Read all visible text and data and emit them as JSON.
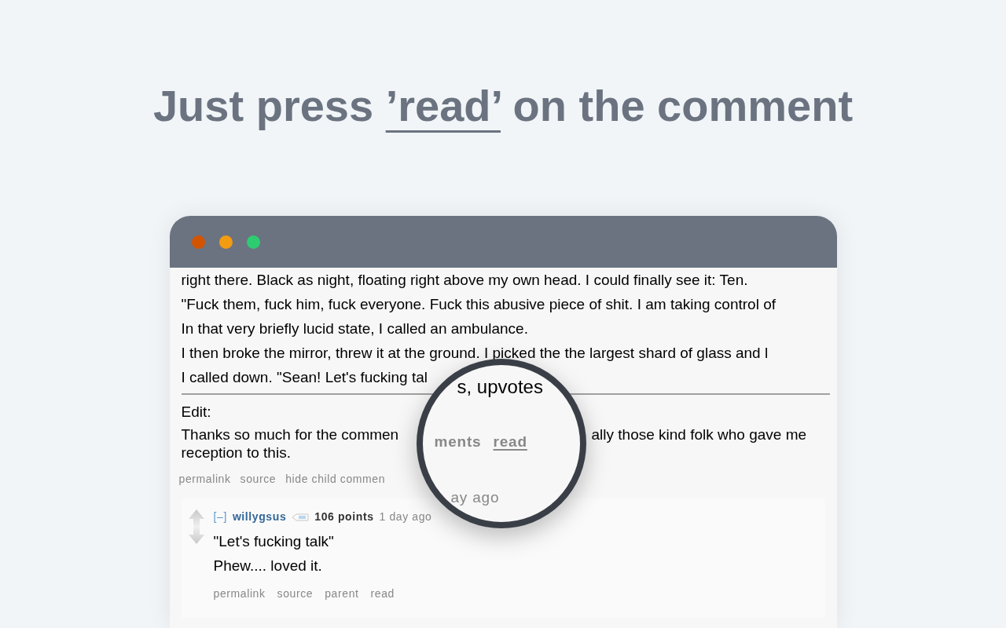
{
  "heading": {
    "before": "Just press",
    "link": "’read’",
    "after": "on the comment"
  },
  "window": {
    "controls": [
      {
        "color": "#d35400"
      },
      {
        "color": "#f39c12"
      },
      {
        "color": "#2ecc71"
      }
    ]
  },
  "comment": {
    "lines": [
      "right there. Black as night, floating right above my own head. I could finally see it: Ten.",
      "\"Fuck them, fuck him, fuck everyone. Fuck this abusive piece of shit. I am taking control of",
      "In that very briefly lucid state, I called an ambulance.",
      "I then broke the mirror, threw it at the ground. I picked the the largest shard of glass and l",
      "I called down. \"Sean! Let's fucking tal"
    ],
    "edit_label": "Edit:",
    "edit_parts": [
      "Thanks so much for the commen",
      "ally those kind folk who gave me"
    ],
    "edit_line_2": "reception to this.",
    "links": [
      "permalink",
      "source",
      "hide child commen"
    ]
  },
  "reply": {
    "collapse": "[–]",
    "author": "willygsus",
    "points": "106 points",
    "time": "1 day ago",
    "lines": [
      "\"Let's fucking talk\"",
      "Phew.... loved it."
    ],
    "links": [
      "permalink",
      "source",
      "parent",
      "read"
    ]
  },
  "magnifier": {
    "top_text": "s, upvotes",
    "left_text": "ments",
    "link": "read",
    "bottom_text": "ay ago"
  }
}
